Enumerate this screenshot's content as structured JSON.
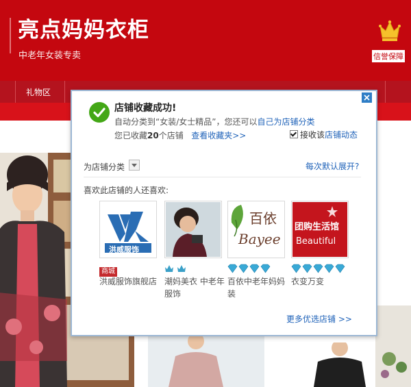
{
  "shop": {
    "title": "亮点妈妈衣柜",
    "subtitle": "中老年女装专卖",
    "trust_badge": "信誉保障"
  },
  "nav": {
    "items": [
      "礼物区"
    ]
  },
  "popup": {
    "title": "店铺收藏成功!",
    "line1_prefix": "自动分类到“女装/女士精品”，您还可以",
    "line1_link": "自己为店铺分类",
    "line2_prefix": "您已收藏",
    "line2_count": "20",
    "line2_suffix": "个店铺",
    "view_favorites": "查看收藏夹>>",
    "subscribe_label_a": "接收该",
    "subscribe_label_b": "店铺动态",
    "subscribe_checked": true,
    "category_label": "为店铺分类",
    "default_expand": "每次默认展开?",
    "also_like": "喜欢此店铺的人还喜欢:",
    "shops": [
      {
        "name": "洪威服饰旗舰店",
        "logo_text": "洪威服饰",
        "badge": "商城",
        "badge_type": "mall",
        "gems": 0
      },
      {
        "name": "潮妈美衣 中老年服饰",
        "logo_text": "",
        "badge": "",
        "badge_type": "crown",
        "gems": 2
      },
      {
        "name": "百依中老年妈妈装",
        "logo_text_cn": "百依",
        "logo_text_en": "Bayee",
        "badge": "",
        "badge_type": "diamond",
        "gems": 4
      },
      {
        "name": "衣变万变",
        "logo_text_cn": "团购生活馆",
        "logo_text_en": "Beautiful",
        "badge": "",
        "badge_type": "diamond",
        "gems": 5
      }
    ],
    "more_shops": "更多优选店铺 >>"
  },
  "colors": {
    "brand_red": "#c4070f",
    "link_blue": "#2063b9",
    "success_green": "#43a716"
  }
}
